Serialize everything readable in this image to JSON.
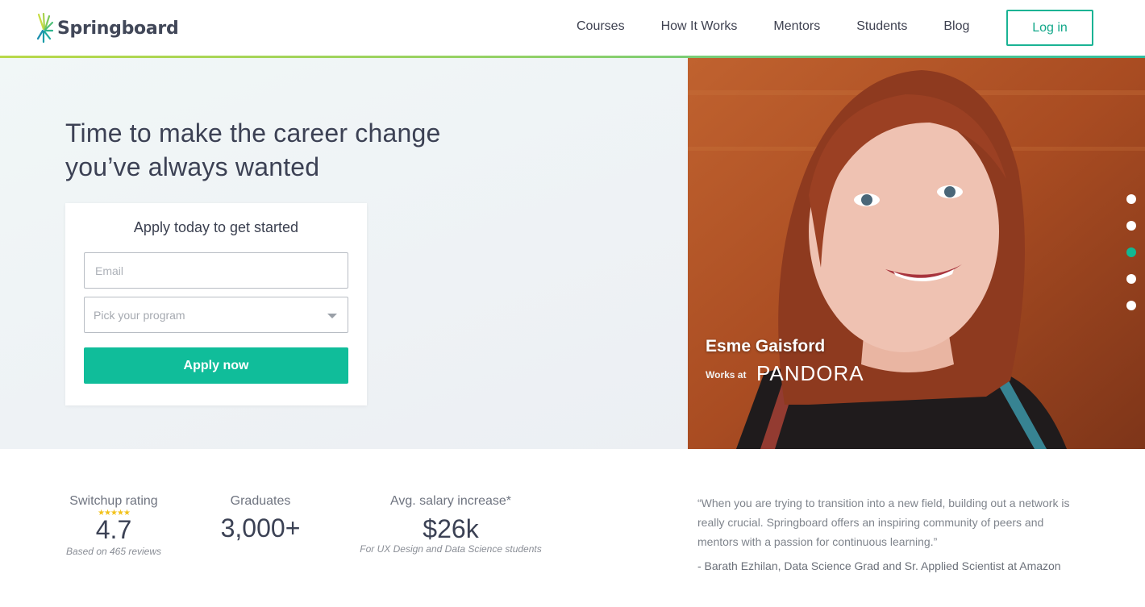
{
  "brand": {
    "name": "Springboard"
  },
  "nav": {
    "links": [
      "Courses",
      "How It Works",
      "Mentors",
      "Students",
      "Blog"
    ],
    "login_label": "Log in"
  },
  "hero": {
    "headline": "Time to make the career change you’ve always wanted",
    "form": {
      "title": "Apply today to get started",
      "email_placeholder": "Email",
      "program_placeholder": "Pick your program",
      "apply_label": "Apply now"
    }
  },
  "mentor": {
    "name": "Esme Gaisford",
    "works_at": "Works at",
    "company": "PANDORA"
  },
  "carousel": {
    "count": 5,
    "active_index": 2
  },
  "stats": {
    "switchup": {
      "label": "Switchup rating",
      "stars": "★★★★★",
      "value": "4.7",
      "note": "Based on 465 reviews"
    },
    "graduates": {
      "label": "Graduates",
      "value": "3,000+"
    },
    "salary": {
      "label": "Avg. salary increase*",
      "value": "$26k",
      "note": "For UX Design and Data Science students"
    }
  },
  "testimonial": {
    "quote": "“When you are trying to transition into a new field, building out a network is really crucial. Springboard offers an inspiring community of peers and mentors with a passion for continuous learning.”",
    "author": "- Barath Ezhilan, Data Science Grad and Sr. Applied Scientist at Amazon"
  },
  "colors": {
    "accent": "#10bd9a",
    "text_dark": "#3c4154",
    "star": "#f2c21b"
  }
}
